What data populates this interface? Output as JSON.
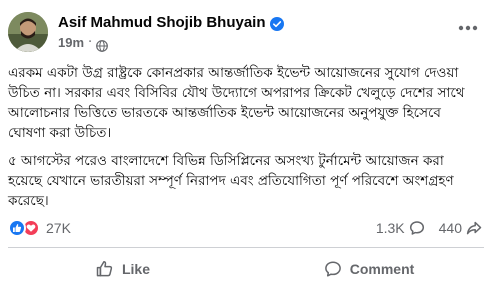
{
  "post": {
    "author": {
      "name": "Asif Mahmud Shojib Bhuyain",
      "verified": true
    },
    "timestamp": "19m",
    "separator": "·",
    "audience_icon": "globe-icon",
    "more_icon": "more-horizontal-icon",
    "paragraphs": [
      "এরকম একটা উগ্র রাষ্ট্রকে কোনপ্রকার আন্তর্জাতিক ইভেন্ট আয়োজনের সুযোগ দেওয়া উচিত না। সরকার এবং বিসিবির যৌথ উদ্যোগে অপরাপর ক্রিকেট খেলুড়ে দেশের সাথে আলোচনার ভিত্তিতে ভারতকে আন্তর্জাতিক ইভেন্ট আয়োজনের অনুপযুক্ত হিসেবে ঘোষণা করা উচিত।",
      "৫ আগস্টের পরেও বাংলাদেশে বিভিন্ন ডিসিপ্লিনের অসংখ্য টুর্নামেন্ট আয়োজন করা হয়েছে যেখানে ভারতীয়রা সম্পূর্ণ নিরাপদ এবং প্রতিযোগিতা পূর্ণ পরিবেশে অংশগ্রহণ করেছে।"
    ],
    "reactions": {
      "icons": [
        "like-reaction-icon",
        "love-reaction-icon"
      ],
      "count": "27K"
    },
    "comments_count": "1.3K",
    "shares_count": "440",
    "actions": {
      "like": "Like",
      "comment": "Comment"
    },
    "colors": {
      "like_blue": "#1877f2",
      "love_red": "#f33e58",
      "verified_blue": "#1877f2",
      "secondary_text": "#65676b"
    }
  }
}
